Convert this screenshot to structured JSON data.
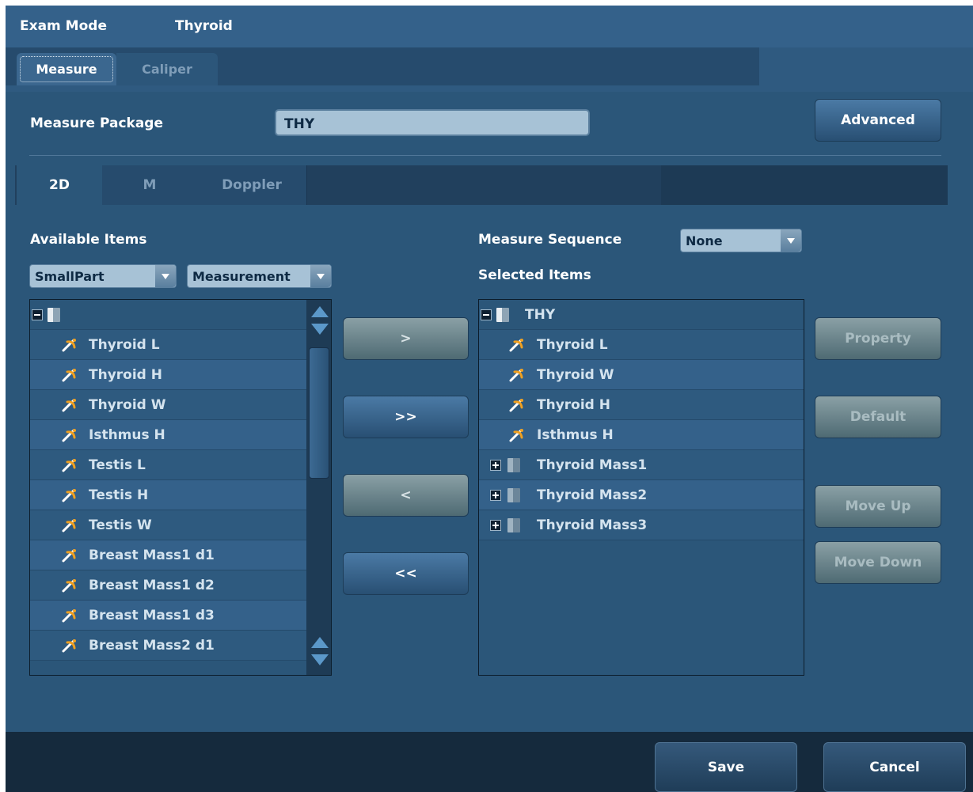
{
  "header": {
    "exam_mode_label": "Exam Mode",
    "exam_mode_value": "Thyroid"
  },
  "tabs": {
    "measure": "Measure",
    "caliper": "Caliper"
  },
  "package": {
    "label": "Measure Package",
    "value": "THY",
    "advanced": "Advanced"
  },
  "subtabs": {
    "d2": "2D",
    "m": "M",
    "doppler": "Doppler"
  },
  "available": {
    "label": "Available Items",
    "region_select": "SmallPart",
    "type_select": "Measurement",
    "items": [
      "Thyroid L",
      "Thyroid H",
      "Thyroid W",
      "Isthmus H",
      "Testis L",
      "Testis H",
      "Testis W",
      "Breast Mass1 d1",
      "Breast Mass1 d2",
      "Breast Mass1 d3",
      "Breast Mass2 d1"
    ]
  },
  "transfer": {
    "add": ">",
    "add_all": ">>",
    "remove": "<",
    "remove_all": "<<"
  },
  "sequence": {
    "label": "Measure Sequence",
    "value": "None"
  },
  "selected": {
    "label": "Selected Items",
    "root": "THY",
    "items": [
      "Thyroid L",
      "Thyroid W",
      "Thyroid H",
      "Isthmus H"
    ],
    "groups": [
      "Thyroid Mass1",
      "Thyroid Mass2",
      "Thyroid Mass3"
    ]
  },
  "side_buttons": {
    "property": "Property",
    "default": "Default",
    "move_up": "Move Up",
    "move_down": "Move Down"
  },
  "footer": {
    "save": "Save",
    "cancel": "Cancel"
  },
  "colors": {
    "panel": "#2b5679",
    "input": "#a7c2d6",
    "caliper_icon": "#f0a020"
  }
}
